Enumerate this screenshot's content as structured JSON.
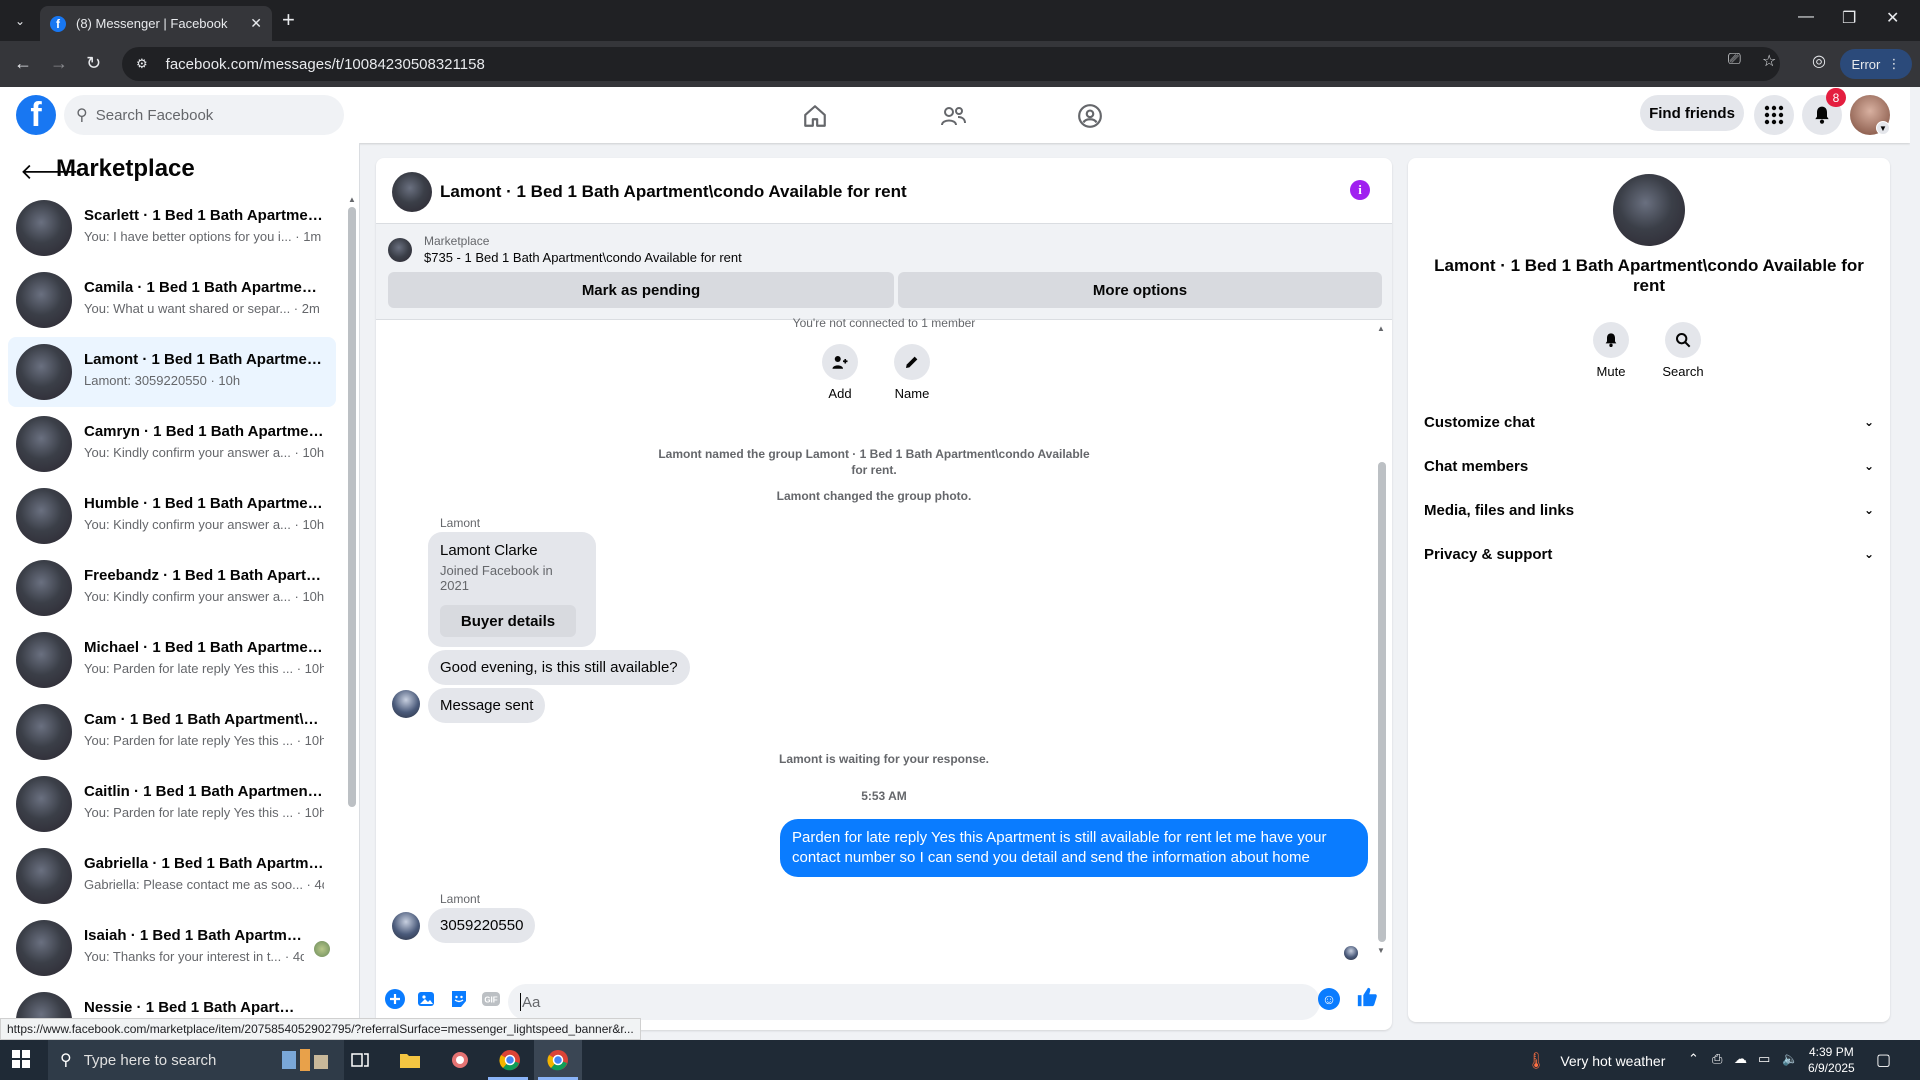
{
  "browser": {
    "tab_title": "(8) Messenger | Facebook",
    "url": "facebook.com/messages/t/10084230508321158",
    "profile_button": "Error",
    "status_url": "https://www.facebook.com/marketplace/item/2075854052902795/?referralSurface=messenger_lightspeed_banner&r..."
  },
  "fb_nav": {
    "logo": "f",
    "search_placeholder": "Search Facebook",
    "find_friends": "Find friends",
    "notification_count": "8"
  },
  "sidebar": {
    "title": "Marketplace",
    "conversations": [
      {
        "name": "Scarlett · 1 Bed 1 Bath Apartment\\condo Available for rent",
        "snippet": "You: I have better options for you i... · 1m"
      },
      {
        "name": "Camila · 1 Bed 1 Bath Apartment\\condo Available for rent",
        "snippet": "You: What u want shared or separ... · 2m"
      },
      {
        "name": "Lamont · 1 Bed 1 Bath Apartment\\condo Available for rent",
        "snippet": "Lamont: 3059220550 · 10h"
      },
      {
        "name": "Camryn · 1 Bed 1 Bath Apartment\\condo Available for rent",
        "snippet": "You: Kindly confirm your answer a... · 10h"
      },
      {
        "name": "Humble · 1 Bed 1 Bath Apartment\\condo Available for rent",
        "snippet": "You: Kindly confirm your answer a... · 10h"
      },
      {
        "name": "Freebandz · 1 Bed 1 Bath Apartment\\condo Available for rent",
        "snippet": "You: Kindly confirm your answer a... · 10h"
      },
      {
        "name": "Michael · 1 Bed 1 Bath Apartment\\condo Available for rent",
        "snippet": "You: Parden for late reply Yes this ... · 10h"
      },
      {
        "name": "Cam · 1 Bed 1 Bath Apartment\\condo Available for rent",
        "snippet": "You: Parden for late reply Yes this ... · 10h"
      },
      {
        "name": "Caitlin · 1 Bed 1 Bath Apartment\\condo Available for rent",
        "snippet": "You: Parden for late reply Yes this ... · 10h"
      },
      {
        "name": "Gabriella · 1 Bed 1 Bath Apartment\\condo Available for rent",
        "snippet": "Gabriella: Please contact me as soo... · 4d"
      },
      {
        "name": "Isaiah · 1 Bed 1 Bath Apartment\\condo Available for rent",
        "snippet": "You: Thanks for your interest in t... · 4d"
      },
      {
        "name": "Nessie · 1 Bed 1 Bath Apartment\\condo Available for rent",
        "snippet": ""
      }
    ]
  },
  "chat": {
    "title": "Lamont · 1 Bed 1 Bath Apartment\\condo Available for rent",
    "marketplace_label": "Marketplace",
    "listing": "$735 - 1 Bed 1 Bath Apartment\\condo Available for rent",
    "mark_pending": "Mark as pending",
    "more_options": "More options",
    "cut_notice": "You're not connected to 1 member",
    "add_label": "Add",
    "name_label": "Name",
    "sys_named": "Lamont named the group Lamont · 1 Bed 1 Bath Apartment\\condo Available for rent.",
    "sys_photo": "Lamont changed the group photo.",
    "sender": "Lamont",
    "card_name": "Lamont Clarke",
    "card_sub": "Joined Facebook in 2021",
    "card_btn": "Buyer details",
    "msg1": "Good evening, is this still available?",
    "msg2": "Message sent",
    "waiting": "Lamont is waiting for your response.",
    "time": "5:53 AM",
    "reply": "Parden for late reply  Yes this Apartment is still available for rent let me have your contact number so I can send you detail and send the information about home",
    "sender2": "Lamont",
    "msg3": "3059220550",
    "composer_placeholder": "Aa"
  },
  "info_panel": {
    "title": "Lamont · 1 Bed 1 Bath Apartment\\condo Available for rent",
    "mute": "Mute",
    "search": "Search",
    "sections": [
      "Customize chat",
      "Chat members",
      "Media, files and links",
      "Privacy & support"
    ]
  },
  "taskbar": {
    "search_placeholder": "Type here to search",
    "weather": "Very hot weather",
    "time": "4:39 PM",
    "date": "6/9/2025"
  },
  "colors": {
    "fb_blue": "#1877f2",
    "messenger_blue": "#0a7cff",
    "badge_red": "#e41e3f",
    "info_purple": "#a020f0"
  }
}
